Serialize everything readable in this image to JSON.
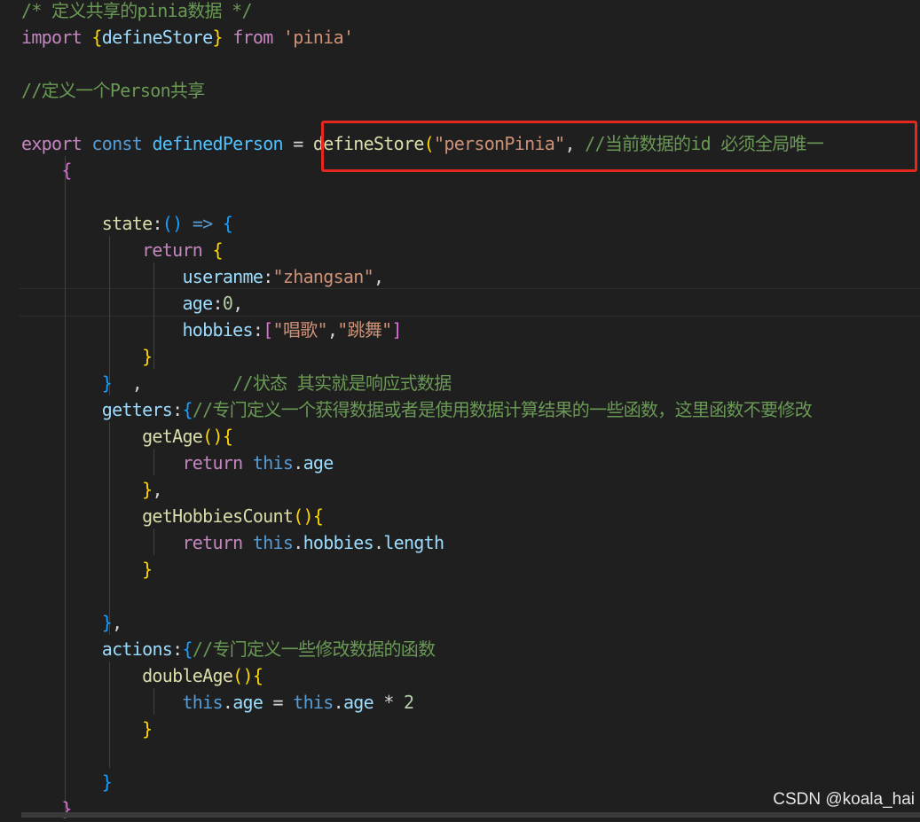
{
  "editor": {
    "lines": [
      [
        {
          "t": "/* 定义共享的pinia数据 */",
          "c": "com"
        }
      ],
      [
        {
          "t": "import ",
          "c": "kw"
        },
        {
          "t": "{",
          "c": "b-gold"
        },
        {
          "t": "defineStore",
          "c": "var"
        },
        {
          "t": "}",
          "c": "b-gold"
        },
        {
          "t": " ",
          "c": "op"
        },
        {
          "t": "from",
          "c": "kw"
        },
        {
          "t": " ",
          "c": "op"
        },
        {
          "t": "'pinia'",
          "c": "str"
        }
      ],
      [],
      [
        {
          "t": "//定义一个Person共享",
          "c": "com"
        }
      ],
      [],
      [
        {
          "t": "export ",
          "c": "kw"
        },
        {
          "t": "const ",
          "c": "decl"
        },
        {
          "t": "definedPerson",
          "c": "const"
        },
        {
          "t": " = ",
          "c": "op"
        },
        {
          "t": "defineStore",
          "c": "fn"
        },
        {
          "t": "(",
          "c": "b-gold"
        },
        {
          "t": "\"personPinia\"",
          "c": "str"
        },
        {
          "t": ", ",
          "c": "op"
        },
        {
          "t": "//当前数据的id 必须全局唯一",
          "c": "com"
        }
      ],
      [
        {
          "t": "    ",
          "c": "op"
        },
        {
          "t": "{",
          "c": "b-purple"
        }
      ],
      [],
      [
        {
          "t": "        ",
          "c": "op"
        },
        {
          "t": "state",
          "c": "fn"
        },
        {
          "t": ":",
          "c": "op"
        },
        {
          "t": "()",
          "c": "b-blue"
        },
        {
          "t": " ",
          "c": "op"
        },
        {
          "t": "=>",
          "c": "decl"
        },
        {
          "t": " ",
          "c": "op"
        },
        {
          "t": "{",
          "c": "b-blue"
        }
      ],
      [
        {
          "t": "            ",
          "c": "op"
        },
        {
          "t": "return ",
          "c": "kw"
        },
        {
          "t": "{",
          "c": "b-gold"
        }
      ],
      [
        {
          "t": "                ",
          "c": "op"
        },
        {
          "t": "useranme",
          "c": "prop"
        },
        {
          "t": ":",
          "c": "op"
        },
        {
          "t": "\"zhangsan\"",
          "c": "str"
        },
        {
          "t": ",",
          "c": "op"
        }
      ],
      [
        {
          "t": "                ",
          "c": "op"
        },
        {
          "t": "age",
          "c": "prop"
        },
        {
          "t": ":",
          "c": "op"
        },
        {
          "t": "0",
          "c": "num"
        },
        {
          "t": ",",
          "c": "op"
        }
      ],
      [
        {
          "t": "                ",
          "c": "op"
        },
        {
          "t": "hobbies",
          "c": "prop"
        },
        {
          "t": ":",
          "c": "op"
        },
        {
          "t": "[",
          "c": "b-purple"
        },
        {
          "t": "\"唱歌\"",
          "c": "str"
        },
        {
          "t": ",",
          "c": "op"
        },
        {
          "t": "\"跳舞\"",
          "c": "str"
        },
        {
          "t": "]",
          "c": "b-purple"
        }
      ],
      [
        {
          "t": "            ",
          "c": "op"
        },
        {
          "t": "}",
          "c": "b-gold"
        }
      ],
      [
        {
          "t": "        ",
          "c": "op"
        },
        {
          "t": "}",
          "c": "b-blue"
        },
        {
          "t": "  ,         ",
          "c": "op"
        },
        {
          "t": "//状态 其实就是响应式数据",
          "c": "com"
        }
      ],
      [
        {
          "t": "        ",
          "c": "op"
        },
        {
          "t": "getters",
          "c": "prop"
        },
        {
          "t": ":",
          "c": "op"
        },
        {
          "t": "{",
          "c": "b-blue"
        },
        {
          "t": "//专门定义一个获得数据或者是使用数据计算结果的一些函数，这里函数不要修改",
          "c": "com"
        }
      ],
      [
        {
          "t": "            ",
          "c": "op"
        },
        {
          "t": "getAge",
          "c": "fn"
        },
        {
          "t": "()",
          "c": "b-gold"
        },
        {
          "t": "{",
          "c": "b-gold"
        }
      ],
      [
        {
          "t": "                ",
          "c": "op"
        },
        {
          "t": "return ",
          "c": "kw"
        },
        {
          "t": "this",
          "c": "decl"
        },
        {
          "t": ".",
          "c": "op"
        },
        {
          "t": "age",
          "c": "prop"
        }
      ],
      [
        {
          "t": "            ",
          "c": "op"
        },
        {
          "t": "}",
          "c": "b-gold"
        },
        {
          "t": ",",
          "c": "op"
        }
      ],
      [
        {
          "t": "            ",
          "c": "op"
        },
        {
          "t": "getHobbiesCount",
          "c": "fn"
        },
        {
          "t": "()",
          "c": "b-gold"
        },
        {
          "t": "{",
          "c": "b-gold"
        }
      ],
      [
        {
          "t": "                ",
          "c": "op"
        },
        {
          "t": "return ",
          "c": "kw"
        },
        {
          "t": "this",
          "c": "decl"
        },
        {
          "t": ".",
          "c": "op"
        },
        {
          "t": "hobbies",
          "c": "prop"
        },
        {
          "t": ".",
          "c": "op"
        },
        {
          "t": "length",
          "c": "prop"
        }
      ],
      [
        {
          "t": "            ",
          "c": "op"
        },
        {
          "t": "}",
          "c": "b-gold"
        }
      ],
      [],
      [
        {
          "t": "        ",
          "c": "op"
        },
        {
          "t": "}",
          "c": "b-blue"
        },
        {
          "t": ",",
          "c": "op"
        }
      ],
      [
        {
          "t": "        ",
          "c": "op"
        },
        {
          "t": "actions",
          "c": "prop"
        },
        {
          "t": ":",
          "c": "op"
        },
        {
          "t": "{",
          "c": "b-blue"
        },
        {
          "t": "//专门定义一些修改数据的函数",
          "c": "com"
        }
      ],
      [
        {
          "t": "            ",
          "c": "op"
        },
        {
          "t": "doubleAge",
          "c": "fn"
        },
        {
          "t": "()",
          "c": "b-gold"
        },
        {
          "t": "{",
          "c": "b-gold"
        }
      ],
      [
        {
          "t": "                ",
          "c": "op"
        },
        {
          "t": "this",
          "c": "decl"
        },
        {
          "t": ".",
          "c": "op"
        },
        {
          "t": "age",
          "c": "prop"
        },
        {
          "t": " = ",
          "c": "op"
        },
        {
          "t": "this",
          "c": "decl"
        },
        {
          "t": ".",
          "c": "op"
        },
        {
          "t": "age",
          "c": "prop"
        },
        {
          "t": " * ",
          "c": "op"
        },
        {
          "t": "2",
          "c": "num"
        }
      ],
      [
        {
          "t": "            ",
          "c": "op"
        },
        {
          "t": "}",
          "c": "b-gold"
        }
      ],
      [],
      [
        {
          "t": "        ",
          "c": "op"
        },
        {
          "t": "}",
          "c": "b-blue"
        }
      ],
      [
        {
          "t": "    ",
          "c": "op"
        },
        {
          "t": "}",
          "c": "b-purple"
        }
      ]
    ]
  },
  "watermark": {
    "text": "CSDN @koala_hai"
  },
  "colors": {
    "background": "#1f1f1f",
    "highlight_box": "#e5281f",
    "comment": "#6a9955",
    "keyword": "#c586c0",
    "string": "#ce9178"
  }
}
